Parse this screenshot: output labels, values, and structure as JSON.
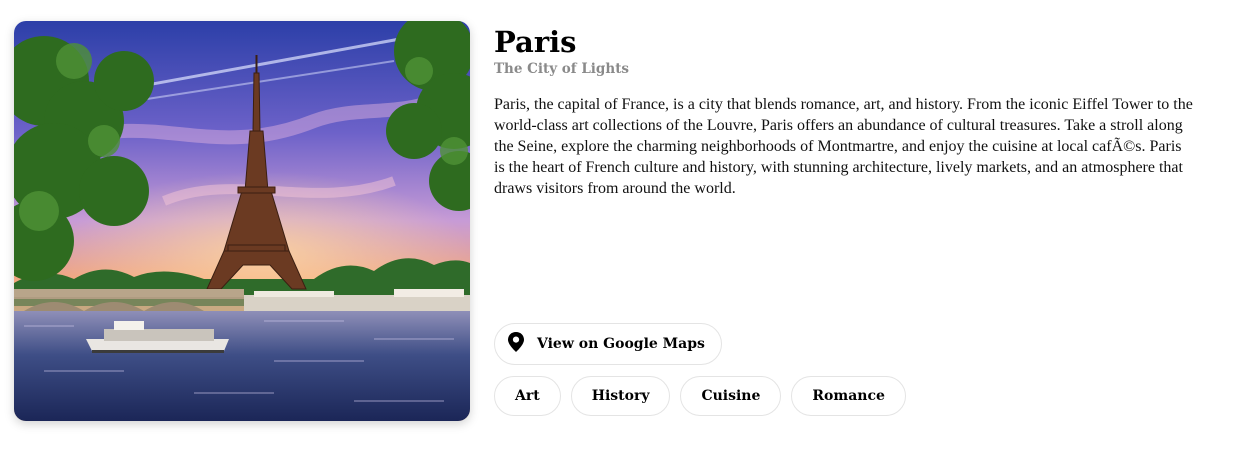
{
  "city": {
    "name": "Paris",
    "tagline": "The City of Lights",
    "description": "Paris, the capital of France, is a city that blends romance, art, and history. From the iconic Eiffel Tower to the world-class art collections of the Louvre, Paris offers an abundance of cultural treasures. Take a stroll along the Seine, explore the charming neighborhoods of Montmartre, and enjoy the cuisine at local cafÃ©s. Paris is the heart of French culture and history, with stunning architecture, lively markets, and an atmosphere that draws visitors from around the world."
  },
  "image": {
    "subject": "Eiffel Tower at sunset over the Seine"
  },
  "maps_button": {
    "label": "View on Google Maps",
    "icon": "map-pin-icon"
  },
  "tags": [
    "Art",
    "History",
    "Cuisine",
    "Romance"
  ]
}
